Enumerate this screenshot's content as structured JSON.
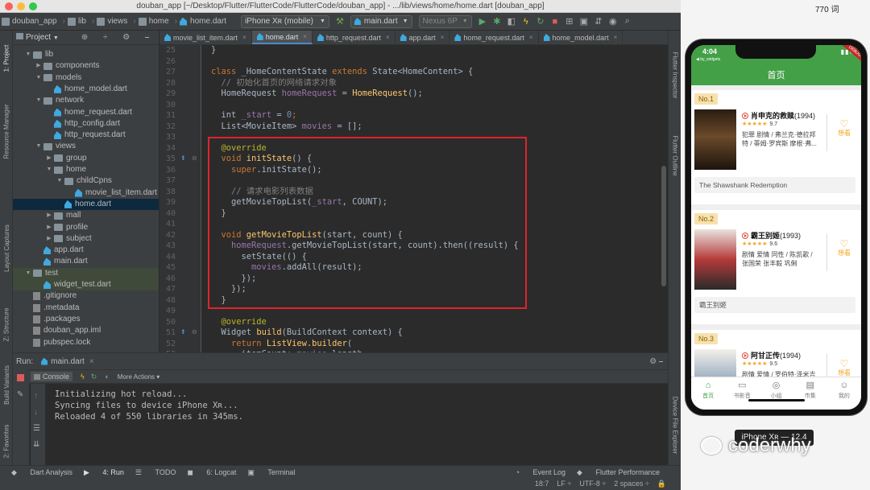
{
  "window": {
    "title": "douban_app [~/Desktop/Flutter/FlutterCode/FlutterCode/douban_app] - .../lib/views/home/home.dart [douban_app]"
  },
  "toolbar": {
    "breadcrumbs": [
      "douban_app",
      "lib",
      "views",
      "home",
      "home.dart"
    ],
    "device": "iPhone Xʀ (mobile)",
    "run_config": "main.dart",
    "avd": "Nexus 6P"
  },
  "left_tools": [
    "1: Project",
    "Resource Manager",
    "Layout Captures",
    "Z: Structure",
    "Build Variants",
    "2: Favorites"
  ],
  "right_tools": [
    "Flutter Inspector",
    "Flutter Outline",
    "Device File Explorer"
  ],
  "project": {
    "header": "Project",
    "tree": [
      {
        "label": "lib",
        "indent": 1,
        "type": "folder",
        "open": true
      },
      {
        "label": "components",
        "indent": 2,
        "type": "folder",
        "open": false
      },
      {
        "label": "models",
        "indent": 2,
        "type": "folder",
        "open": true
      },
      {
        "label": "home_model.dart",
        "indent": 3,
        "type": "dart"
      },
      {
        "label": "network",
        "indent": 2,
        "type": "folder",
        "open": true
      },
      {
        "label": "home_request.dart",
        "indent": 3,
        "type": "dart"
      },
      {
        "label": "http_config.dart",
        "indent": 3,
        "type": "dart"
      },
      {
        "label": "http_request.dart",
        "indent": 3,
        "type": "dart"
      },
      {
        "label": "views",
        "indent": 2,
        "type": "folder",
        "open": true
      },
      {
        "label": "group",
        "indent": 3,
        "type": "folder",
        "open": false
      },
      {
        "label": "home",
        "indent": 3,
        "type": "folder",
        "open": true
      },
      {
        "label": "childCpns",
        "indent": 4,
        "type": "folder",
        "open": true
      },
      {
        "label": "movie_list_item.dart",
        "indent": 5,
        "type": "dart"
      },
      {
        "label": "home.dart",
        "indent": 4,
        "type": "dart",
        "selected": true
      },
      {
        "label": "mall",
        "indent": 3,
        "type": "folder",
        "open": false
      },
      {
        "label": "profile",
        "indent": 3,
        "type": "folder",
        "open": false
      },
      {
        "label": "subject",
        "indent": 3,
        "type": "folder",
        "open": false
      },
      {
        "label": "app.dart",
        "indent": 2,
        "type": "dart"
      },
      {
        "label": "main.dart",
        "indent": 2,
        "type": "dart"
      },
      {
        "label": "test",
        "indent": 1,
        "type": "folder",
        "open": true,
        "test": true
      },
      {
        "label": "widget_test.dart",
        "indent": 2,
        "type": "dart",
        "test": true
      },
      {
        "label": ".gitignore",
        "indent": 1,
        "type": "file"
      },
      {
        "label": ".metadata",
        "indent": 1,
        "type": "file"
      },
      {
        "label": ".packages",
        "indent": 1,
        "type": "file"
      },
      {
        "label": "douban_app.iml",
        "indent": 1,
        "type": "file"
      },
      {
        "label": "pubspec.lock",
        "indent": 1,
        "type": "file"
      }
    ]
  },
  "editor_tabs": [
    {
      "label": "movie_list_item.dart",
      "active": false
    },
    {
      "label": "home.dart",
      "active": true
    },
    {
      "label": "http_request.dart",
      "active": false
    },
    {
      "label": "app.dart",
      "active": false
    },
    {
      "label": "home_request.dart",
      "active": false
    },
    {
      "label": "home_model.dart",
      "active": false
    }
  ],
  "code_lines": [
    {
      "n": "25",
      "tokens": [
        [
          "}",
          ""
        ]
      ]
    },
    {
      "n": "26",
      "tokens": []
    },
    {
      "n": "27",
      "tokens": [
        [
          "class ",
          "kw"
        ],
        [
          "_HomeContentState ",
          "cls"
        ],
        [
          "extends ",
          "kw"
        ],
        [
          "State<HomeContent> {",
          "cls"
        ]
      ]
    },
    {
      "n": "28",
      "tokens": [
        [
          "  // 初始化首页的网络请求对象",
          "cm"
        ]
      ]
    },
    {
      "n": "29",
      "tokens": [
        [
          "  HomeRequest ",
          "cls"
        ],
        [
          "homeRequest",
          "fld"
        ],
        [
          " = ",
          ""
        ],
        [
          "HomeRequest",
          "fn"
        ],
        [
          "();",
          ""
        ]
      ]
    },
    {
      "n": "30",
      "tokens": []
    },
    {
      "n": "31",
      "tokens": [
        [
          "  int ",
          "cls"
        ],
        [
          "_start",
          "fld"
        ],
        [
          " = ",
          ""
        ],
        [
          "0",
          "num"
        ],
        [
          ";",
          "kw"
        ]
      ]
    },
    {
      "n": "32",
      "tokens": [
        [
          "  List<MovieItem> ",
          "cls"
        ],
        [
          "movies",
          "fld"
        ],
        [
          " = [];",
          ""
        ]
      ]
    },
    {
      "n": "33",
      "tokens": []
    },
    {
      "n": "34",
      "tokens": [
        [
          "  @override",
          "an"
        ]
      ]
    },
    {
      "n": "35",
      "tokens": [
        [
          "  void ",
          "kw"
        ],
        [
          "initState",
          "fn"
        ],
        [
          "() {",
          ""
        ]
      ]
    },
    {
      "n": "36",
      "tokens": [
        [
          "    super",
          "kw"
        ],
        [
          ".initState();",
          ""
        ]
      ]
    },
    {
      "n": "37",
      "tokens": []
    },
    {
      "n": "38",
      "tokens": [
        [
          "    // 请求电影列表数据",
          "cm"
        ]
      ]
    },
    {
      "n": "39",
      "tokens": [
        [
          "    getMovieTopList(",
          ""
        ],
        [
          "_start",
          "fld"
        ],
        [
          ", COUNT);",
          ""
        ]
      ]
    },
    {
      "n": "40",
      "tokens": [
        [
          "  }",
          ""
        ]
      ]
    },
    {
      "n": "41",
      "tokens": []
    },
    {
      "n": "42",
      "tokens": [
        [
          "  void ",
          "kw"
        ],
        [
          "getMovieTopList",
          "fn"
        ],
        [
          "(start, count) {",
          ""
        ]
      ]
    },
    {
      "n": "43",
      "tokens": [
        [
          "    homeRequest",
          "fld"
        ],
        [
          ".getMovieTopList(start, count).then((result) {",
          ""
        ]
      ]
    },
    {
      "n": "44",
      "tokens": [
        [
          "      setState(() {",
          ""
        ]
      ]
    },
    {
      "n": "45",
      "tokens": [
        [
          "        movies",
          "fld"
        ],
        [
          ".addAll(result);",
          ""
        ]
      ]
    },
    {
      "n": "46",
      "tokens": [
        [
          "      });",
          ""
        ]
      ]
    },
    {
      "n": "47",
      "tokens": [
        [
          "    });",
          ""
        ]
      ]
    },
    {
      "n": "48",
      "tokens": [
        [
          "  }",
          ""
        ]
      ]
    },
    {
      "n": "49",
      "tokens": []
    },
    {
      "n": "50",
      "tokens": [
        [
          "  @override",
          "an"
        ]
      ]
    },
    {
      "n": "51",
      "tokens": [
        [
          "  Widget ",
          "cls"
        ],
        [
          "build",
          "fn"
        ],
        [
          "(BuildContext context) {",
          ""
        ]
      ]
    },
    {
      "n": "52",
      "tokens": [
        [
          "    return ",
          "kw"
        ],
        [
          "ListView.builder",
          "fn"
        ],
        [
          "(",
          ""
        ]
      ]
    },
    {
      "n": "53",
      "tokens": [
        [
          "      itemCount: ",
          ""
        ],
        [
          "movies",
          "fld"
        ],
        [
          ".length,",
          ""
        ]
      ]
    }
  ],
  "run": {
    "label": "Run:",
    "config": "main.dart",
    "console_tab": "Console",
    "more_actions": "More Actions",
    "lines": [
      "Initializing hot reload...",
      "Syncing files to device iPhone Xʀ...",
      "Reloaded 4 of 550 libraries in 345ms."
    ]
  },
  "bottom_tools": [
    "Dart Analysis",
    "4: Run",
    "TODO",
    "6: Logcat",
    "Terminal",
    "Event Log",
    "Flutter Performance"
  ],
  "status": {
    "position": "18:7",
    "line_ending": "LF",
    "encoding": "UTF-8",
    "indent": "2 spaces"
  },
  "words": "770 词",
  "phone": {
    "time": "4:04",
    "carrier": "◀ by_widgets",
    "appbar_title": "首页",
    "movies": [
      {
        "rank": "No.1",
        "title": "肖申克的救赎",
        "year": "(1994)",
        "score": "9.7",
        "stars": "★★★★★",
        "desc": "犯罪 剧情 / 弗兰克·德拉邦特 / 蒂姆·罗宾斯 摩根·弗...",
        "original": "The Shawshank Redemption",
        "want": "想看"
      },
      {
        "rank": "No.2",
        "title": "霸王别姬",
        "year": "(1993)",
        "score": "9.6",
        "stars": "★★★★★",
        "desc": "剧情 爱情 同性 / 陈凯歌 / 张国荣 张丰毅 巩俐",
        "original": "霸王别姬",
        "want": "想看"
      },
      {
        "rank": "No.3",
        "title": "阿甘正传",
        "year": "(1994)",
        "score": "9.5",
        "stars": "★★★★★",
        "desc": "剧情 爱情 / 罗伯特·泽米吉",
        "want": "想看"
      }
    ],
    "tabs": [
      {
        "label": "首页",
        "icon": "⌂",
        "active": true
      },
      {
        "label": "书影音",
        "icon": "▭",
        "active": false
      },
      {
        "label": "小组",
        "icon": "◎",
        "active": false
      },
      {
        "label": "市集",
        "icon": "▤",
        "active": false
      },
      {
        "label": "我的",
        "icon": "☺",
        "active": false
      }
    ]
  },
  "tooltip": "iPhone Xʀ — 12.4",
  "watermark": "coderwhy",
  "colors": {
    "accent_green": "#43a047",
    "highlight_box": "#e0232a",
    "ide_bg": "#2b2b2b"
  }
}
